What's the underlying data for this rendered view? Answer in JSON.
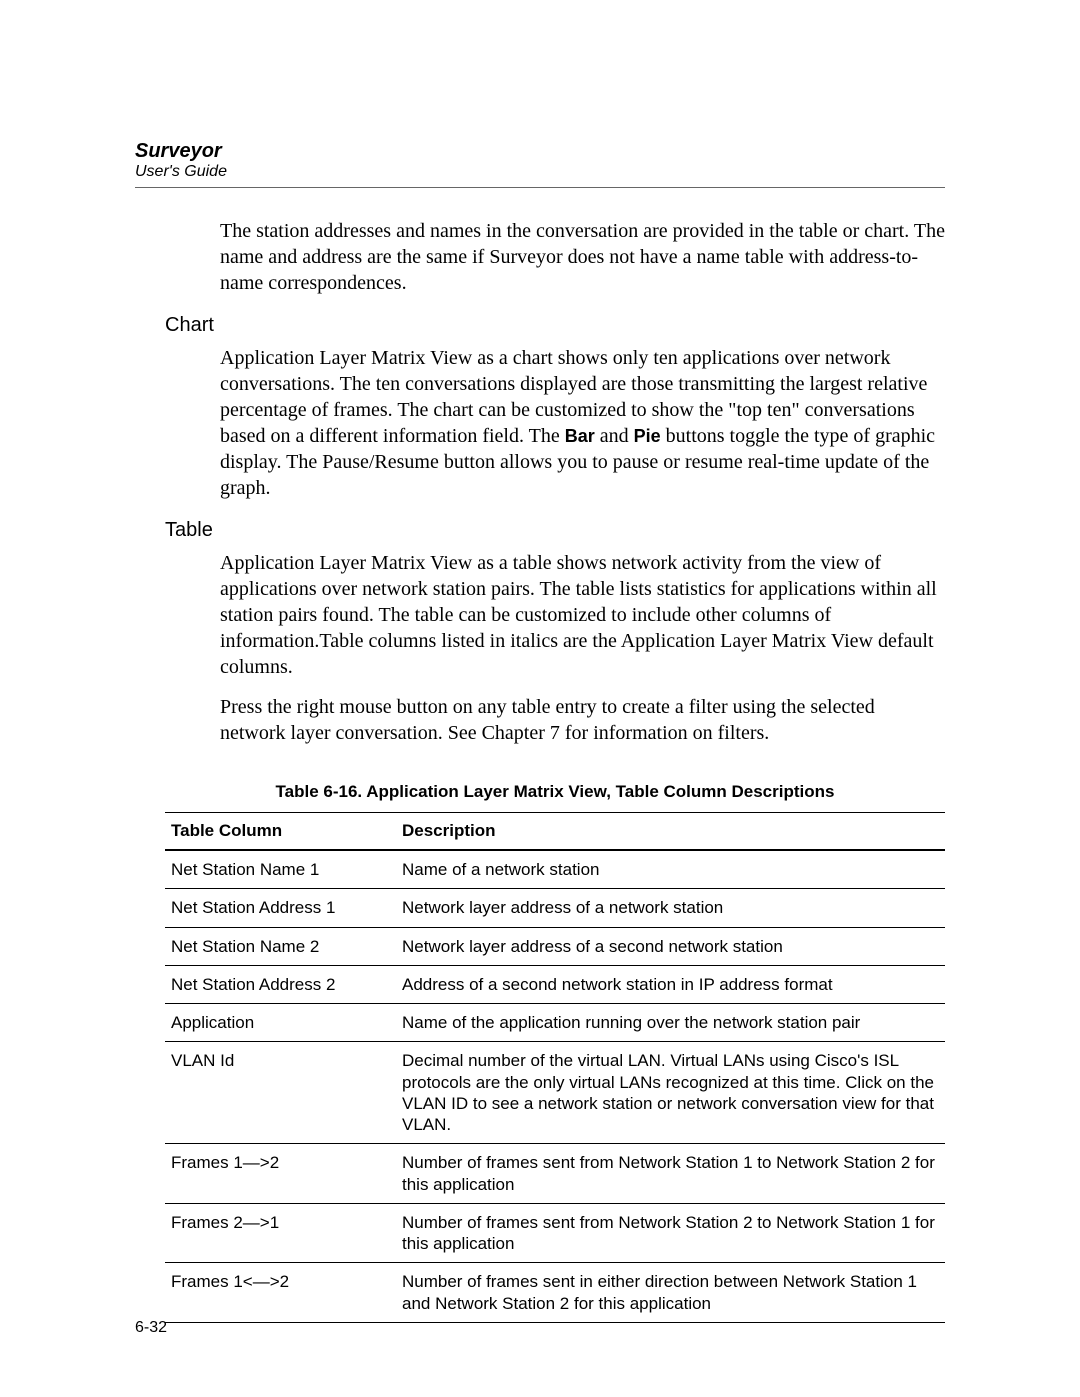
{
  "header": {
    "title": "Surveyor",
    "subtitle": "User's Guide"
  },
  "intro_para": "The station addresses and names in the conversation are provided in the table or chart. The name and address are the same if Surveyor does not have a name table with address-to-name correspondences.",
  "section_chart": {
    "heading": "Chart",
    "para_pre": "Application Layer Matrix View as a chart shows only ten applications over network conversations. The ten conversations displayed are those transmitting the largest relative percentage of frames. The chart can be customized to show the \"top ten\" conversations based on a different information field. The ",
    "bar_label": "Bar",
    "mid1": " and ",
    "pie_label": "Pie",
    "para_post": " buttons toggle the type of graphic display. The Pause/Resume button allows you to pause or resume real-time update of the graph."
  },
  "section_table": {
    "heading": "Table",
    "para1": "Application Layer Matrix View as a table shows network activity from the view of applications over network station pairs. The table lists statistics for applications within all station pairs found. The table can be customized to include other columns of information.Table columns listed in italics are the Application Layer Matrix View default columns.",
    "para2": "Press the right mouse button on any table entry to create a filter using the selected network layer conversation. See Chapter 7 for information on filters."
  },
  "table": {
    "caption": "Table 6-16. Application Layer Matrix View, Table Column Descriptions",
    "head_col1": "Table Column",
    "head_col2": "Description",
    "rows": [
      {
        "c1": "Net Station Name 1",
        "c2": "Name of a network station"
      },
      {
        "c1": "Net Station Address 1",
        "c2": "Network layer address of a network station"
      },
      {
        "c1": "Net Station Name 2",
        "c2": "Network layer address of a second network station"
      },
      {
        "c1": "Net Station Address 2",
        "c2": "Address of a second network station in IP address format"
      },
      {
        "c1": "Application",
        "c2": "Name of the application running over the network station pair"
      },
      {
        "c1": "VLAN Id",
        "c2": "Decimal number of the virtual LAN. Virtual LANs using Cisco's ISL protocols are the only virtual LANs recognized at this time. Click on the VLAN ID to see a network station or network conversation view for that VLAN."
      },
      {
        "c1": "Frames 1—>2",
        "c2": "Number of frames sent from Network Station 1 to Network Station 2 for this application"
      },
      {
        "c1": "Frames 2—>1",
        "c2": "Number of frames sent from Network Station 2 to Network Station 1 for this application"
      },
      {
        "c1": "Frames 1<—>2",
        "c2": "Number of frames sent in either direction between Network Station 1 and Network Station 2 for this application"
      }
    ]
  },
  "page_number": "6-32"
}
